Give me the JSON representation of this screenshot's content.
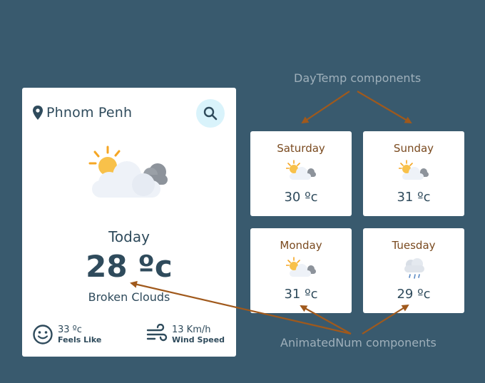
{
  "annotations": {
    "daytemp_label": "DayTemp components",
    "animatednum_label": "AnimatedNum components"
  },
  "main": {
    "city": "Phnom Penh",
    "day_label": "Today",
    "temperature": "28 ºc",
    "description": "Broken Clouds",
    "feels_like_value": "33 ºc",
    "feels_like_label": "Feels Like",
    "wind_value": "13 Km/h",
    "wind_label": "Wind Speed"
  },
  "forecast": [
    {
      "day": "Saturday",
      "temp": "30 ºc",
      "icon": "sun-behind-cloud-icon"
    },
    {
      "day": "Sunday",
      "temp": "31 ºc",
      "icon": "sun-behind-cloud-icon"
    },
    {
      "day": "Monday",
      "temp": "31 ºc",
      "icon": "sun-behind-cloud-icon"
    },
    {
      "day": "Tuesday",
      "temp": "29 ºc",
      "icon": "rain-cloud-icon"
    }
  ],
  "colors": {
    "background": "#395a6e",
    "card": "#ffffff",
    "text_dark": "#2f4b5c",
    "day_name": "#7a4a1f",
    "arrow": "#a0591c",
    "search_bg": "#d9f3fb"
  }
}
